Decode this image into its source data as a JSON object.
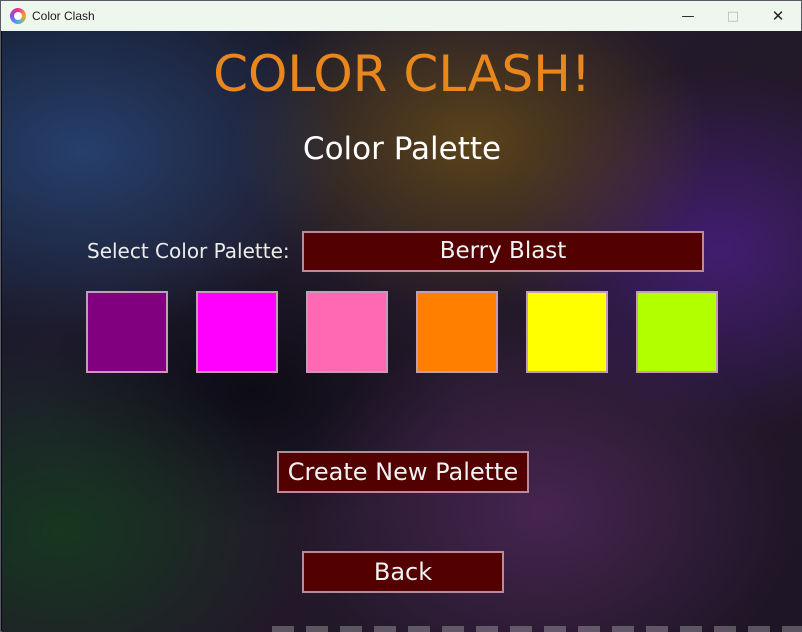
{
  "window": {
    "title": "Color Clash",
    "app_icon": "app-icon",
    "controls": [
      "minimize-icon",
      "maximize-icon",
      "close-icon"
    ]
  },
  "game": {
    "title": "COLOR CLASH!",
    "title_color": "#E8871E",
    "subtitle": "Color Palette"
  },
  "palette_selector": {
    "label": "Select Color Palette:",
    "selected": "Berry Blast"
  },
  "swatches": [
    {
      "color": "#800080"
    },
    {
      "color": "#FF00FF"
    },
    {
      "color": "#FF69B4"
    },
    {
      "color": "#FF7F00"
    },
    {
      "color": "#FFFF00"
    },
    {
      "color": "#B2FF00"
    }
  ],
  "buttons": {
    "create_new_palette": "Create New Palette",
    "back": "Back"
  },
  "colors": {
    "button_bg": "#520000",
    "button_border": "#B98A9A"
  }
}
